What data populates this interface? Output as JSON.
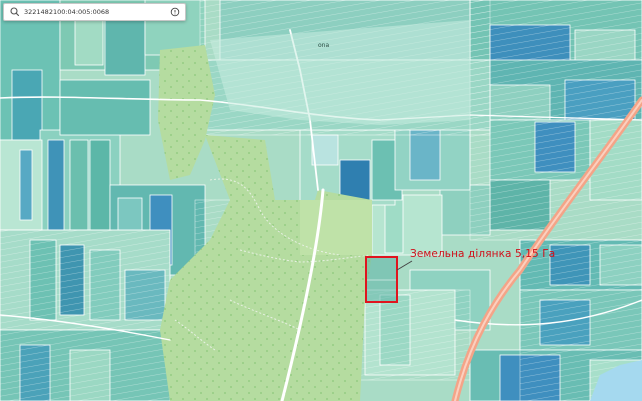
{
  "search": {
    "value": "3221482100:04:005:0068",
    "icon": "search-icon",
    "clear_icon": "info-circle-icon"
  },
  "map": {
    "parcel_label": "Земельна ділянка 5,15 Га",
    "village_label": "ona",
    "colors": {
      "parcel_outline": "#e0141e",
      "road": "#f4a488",
      "forest": "#b5dca0",
      "plot_light": "#b9e6d3",
      "plot_teal": "#5fb9b3",
      "plot_blue": "#3f8fbf"
    }
  }
}
